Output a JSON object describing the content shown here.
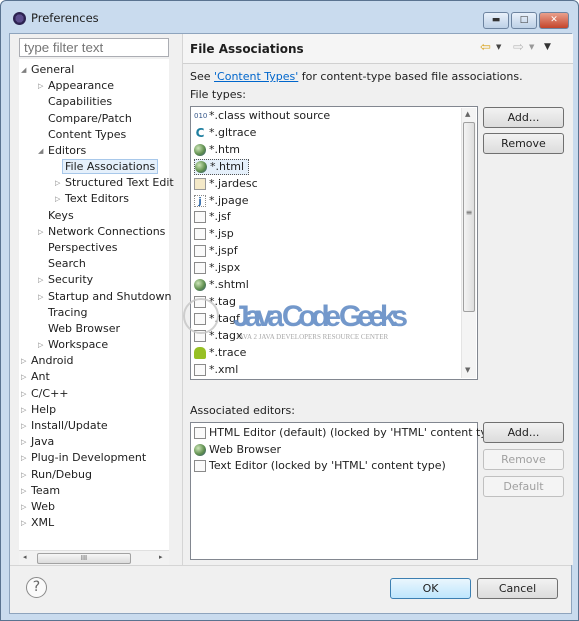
{
  "window": {
    "title": "Preferences",
    "controls": [
      "minimize",
      "maximize",
      "close"
    ]
  },
  "sidebar": {
    "filter_placeholder": "type filter text",
    "items": [
      {
        "label": "General",
        "level": 0,
        "state": "expanded"
      },
      {
        "label": "Appearance",
        "level": 1,
        "state": "collapsed"
      },
      {
        "label": "Capabilities",
        "level": 1,
        "state": "leaf"
      },
      {
        "label": "Compare/Patch",
        "level": 1,
        "state": "leaf"
      },
      {
        "label": "Content Types",
        "level": 1,
        "state": "leaf"
      },
      {
        "label": "Editors",
        "level": 1,
        "state": "expanded"
      },
      {
        "label": "File Associations",
        "level": 2,
        "state": "leaf",
        "selected": true
      },
      {
        "label": "Structured Text Edit",
        "level": 2,
        "state": "collapsed"
      },
      {
        "label": "Text Editors",
        "level": 2,
        "state": "collapsed"
      },
      {
        "label": "Keys",
        "level": 1,
        "state": "leaf"
      },
      {
        "label": "Network Connections",
        "level": 1,
        "state": "collapsed"
      },
      {
        "label": "Perspectives",
        "level": 1,
        "state": "leaf"
      },
      {
        "label": "Search",
        "level": 1,
        "state": "leaf"
      },
      {
        "label": "Security",
        "level": 1,
        "state": "collapsed"
      },
      {
        "label": "Startup and Shutdown",
        "level": 1,
        "state": "collapsed"
      },
      {
        "label": "Tracing",
        "level": 1,
        "state": "leaf"
      },
      {
        "label": "Web Browser",
        "level": 1,
        "state": "leaf"
      },
      {
        "label": "Workspace",
        "level": 1,
        "state": "collapsed"
      },
      {
        "label": "Android",
        "level": 0,
        "state": "collapsed"
      },
      {
        "label": "Ant",
        "level": 0,
        "state": "collapsed"
      },
      {
        "label": "C/C++",
        "level": 0,
        "state": "collapsed"
      },
      {
        "label": "Help",
        "level": 0,
        "state": "collapsed"
      },
      {
        "label": "Install/Update",
        "level": 0,
        "state": "collapsed"
      },
      {
        "label": "Java",
        "level": 0,
        "state": "collapsed"
      },
      {
        "label": "Plug-in Development",
        "level": 0,
        "state": "collapsed"
      },
      {
        "label": "Run/Debug",
        "level": 0,
        "state": "collapsed"
      },
      {
        "label": "Team",
        "level": 0,
        "state": "collapsed"
      },
      {
        "label": "Web",
        "level": 0,
        "state": "collapsed"
      },
      {
        "label": "XML",
        "level": 0,
        "state": "collapsed"
      }
    ],
    "scroll_thumb_grip": "III"
  },
  "page": {
    "title": "File Associations",
    "desc_prefix": "See ",
    "desc_link": "'Content Types'",
    "desc_suffix": " for content-type based file associations.",
    "file_types_label": "File types:",
    "file_types": [
      {
        "name": "*.class without source",
        "icon": "class-file"
      },
      {
        "name": "*.gltrace",
        "icon": "c"
      },
      {
        "name": "*.htm",
        "icon": "globe"
      },
      {
        "name": "*.html",
        "icon": "globe",
        "selected": true
      },
      {
        "name": "*.jardesc",
        "icon": "jar"
      },
      {
        "name": "*.jpage",
        "icon": "j"
      },
      {
        "name": "*.jsf",
        "icon": "doc"
      },
      {
        "name": "*.jsp",
        "icon": "doc"
      },
      {
        "name": "*.jspf",
        "icon": "doc"
      },
      {
        "name": "*.jspx",
        "icon": "doc"
      },
      {
        "name": "*.shtml",
        "icon": "globe"
      },
      {
        "name": "*.tag",
        "icon": "doc"
      },
      {
        "name": "*.tagf",
        "icon": "doc"
      },
      {
        "name": "*.tagx",
        "icon": "doc"
      },
      {
        "name": "*.trace",
        "icon": "android"
      },
      {
        "name": "*.xml",
        "icon": "doc"
      }
    ],
    "add_label": "Add...",
    "remove_label": "Remove",
    "editors_label": "Associated editors:",
    "editors": [
      {
        "name": "HTML Editor (default) (locked by 'HTML' content type)",
        "icon": "doc"
      },
      {
        "name": "Web Browser",
        "icon": "globe"
      },
      {
        "name": "Text Editor (locked by 'HTML' content type)",
        "icon": "doc"
      }
    ],
    "editor_add_label": "Add...",
    "editor_remove_label": "Remove",
    "editor_default_label": "Default"
  },
  "footer": {
    "ok_label": "OK",
    "cancel_label": "Cancel"
  },
  "watermark": {
    "text": "Java Code Geeks",
    "subtext": "Java 2 Java Developers Resource Center"
  }
}
